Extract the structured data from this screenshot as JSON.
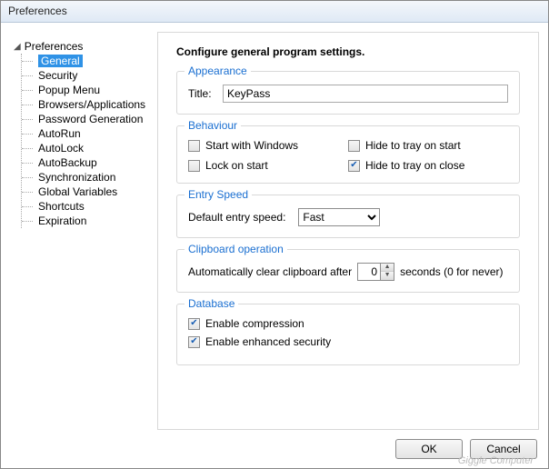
{
  "window": {
    "title": "Preferences"
  },
  "tree": {
    "root": "Preferences",
    "items": [
      "General",
      "Security",
      "Popup Menu",
      "Browsers/Applications",
      "Password Generation",
      "AutoRun",
      "AutoLock",
      "AutoBackup",
      "Synchronization",
      "Global Variables",
      "Shortcuts",
      "Expiration"
    ],
    "selected": 0
  },
  "heading": "Configure general program settings.",
  "appearance": {
    "legend": "Appearance",
    "title_label": "Title:",
    "title_value": "KeyPass"
  },
  "behaviour": {
    "legend": "Behaviour",
    "start_windows": {
      "label": "Start with Windows",
      "checked": false
    },
    "hide_tray_start": {
      "label": "Hide to tray on start",
      "checked": false
    },
    "lock_start": {
      "label": "Lock on start",
      "checked": false
    },
    "hide_tray_close": {
      "label": "Hide to tray on close",
      "checked": true
    }
  },
  "entry_speed": {
    "legend": "Entry Speed",
    "label": "Default entry speed:",
    "value": "Fast",
    "options": [
      "Fast"
    ]
  },
  "clipboard": {
    "legend": "Clipboard operation",
    "prefix": "Automatically clear clipboard after",
    "value": "0",
    "suffix": "seconds (0 for never)"
  },
  "database": {
    "legend": "Database",
    "compression": {
      "label": "Enable compression",
      "checked": true
    },
    "enhanced": {
      "label": "Enable enhanced security",
      "checked": true
    }
  },
  "buttons": {
    "ok": "OK",
    "cancel": "Cancel"
  },
  "watermark": "Giggle Computer"
}
